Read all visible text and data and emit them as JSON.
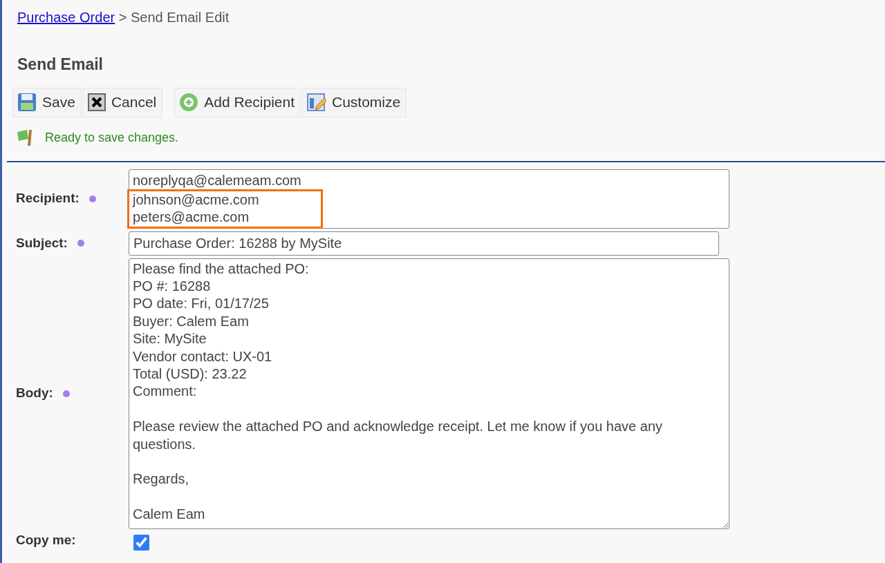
{
  "breadcrumb": {
    "link": "Purchase Order",
    "separator": ">",
    "current": "Send Email Edit"
  },
  "title": "Send Email",
  "toolbar": [
    [
      {
        "label": "Save",
        "kind": "save"
      },
      {
        "label": "Cancel",
        "kind": "cancel"
      }
    ],
    [
      {
        "label": "Add Recipient",
        "kind": "add"
      },
      {
        "label": "Customize",
        "kind": "customize"
      }
    ]
  ],
  "status": {
    "kind": "ready",
    "text": "Ready to save changes."
  },
  "fields": [
    {
      "kind": "lines",
      "label": "Recipient:",
      "required": true,
      "lines": [
        {
          "text": "noreplyqa@calemeam.com",
          "highlighted": false
        },
        {
          "text": "johnson@acme.com",
          "highlighted": true
        },
        {
          "text": "peters@acme.com",
          "highlighted": true
        }
      ]
    },
    {
      "kind": "text",
      "label": "Subject:",
      "required": true,
      "value": "Purchase Order: 16288 by MySite"
    },
    {
      "kind": "area",
      "label": "Body:",
      "required": true,
      "value": "Please find the attached PO:\nPO #: 16288\nPO date: Fri, 01/17/25\nBuyer: Calem Eam\nSite: MySite\nVendor contact: UX-01\nTotal (USD): 23.22\nComment:\n\nPlease review the attached PO and acknowledge receipt. Let me know if you have any questions.\n\nRegards,\n\nCalem Eam"
    },
    {
      "kind": "checkbox",
      "label": "Copy me:",
      "required": false,
      "checked": true
    }
  ]
}
